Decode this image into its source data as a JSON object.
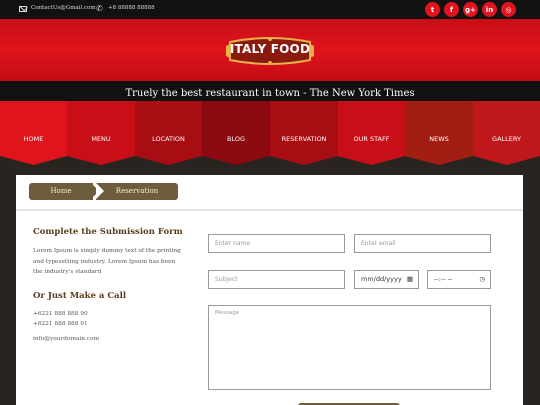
{
  "topbar": {
    "email": "ContactUs@Gmail.com",
    "phone": "+8 88888 88888",
    "socials": [
      {
        "icon": "twitter-icon",
        "glyph": "t"
      },
      {
        "icon": "facebook-icon",
        "glyph": "f"
      },
      {
        "icon": "google-plus-icon",
        "glyph": "g+"
      },
      {
        "icon": "linkedin-icon",
        "glyph": "in"
      },
      {
        "icon": "instagram-icon",
        "glyph": "◎"
      }
    ]
  },
  "header": {
    "logo_text": "ITALY FOOD"
  },
  "tagline": "Truely the best restaurant in town - The New York Times",
  "nav": [
    {
      "label": "HOME",
      "color": "#e0141c"
    },
    {
      "label": "MENU",
      "color": "#c80f18"
    },
    {
      "label": "LOCATION",
      "color": "#a80d13"
    },
    {
      "label": "BLOG",
      "color": "#8a0a0f"
    },
    {
      "label": "RESERVATION",
      "color": "#a80d13"
    },
    {
      "label": "OUR STAFF",
      "color": "#c80f18"
    },
    {
      "label": "NEWS",
      "color": "#a31e12"
    },
    {
      "label": "GALLERY",
      "color": "#c0181a"
    }
  ],
  "breadcrumb": {
    "home": "Home",
    "current": "Reservation"
  },
  "info": {
    "form_heading": "Complete the Submission Form",
    "form_text": "Lorem Ipsum is simply dummy text of the printing and typesetting industry. Lorem Ipsum has been the industry's standard",
    "call_heading": "Or Just Make a Call",
    "phone1": "+6221 888 888 90",
    "phone2": "+6221 888 888 91",
    "email": "info@yourdomain.com"
  },
  "form": {
    "name_placeholder": "Enter name",
    "email_placeholder": "Enter email",
    "subject_placeholder": "Subject",
    "date_placeholder": "mm/dd/yyyy",
    "time_placeholder": "--:-- --",
    "message_placeholder": "Message"
  }
}
